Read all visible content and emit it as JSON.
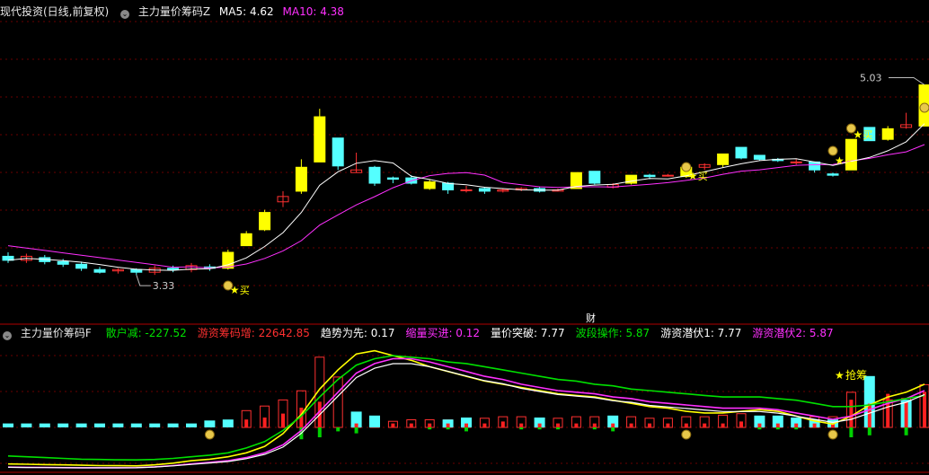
{
  "header_top": {
    "stock": "现代投资(日线,前复权)",
    "indicator": "主力量价筹码Z",
    "ma5": "MA5: 4.62",
    "ma10": "MA10: 4.38"
  },
  "header_bottom": {
    "indicator": "主力量价筹码F",
    "items": [
      {
        "text": "散户减: -227.52",
        "color": "#00e000"
      },
      {
        "text": "游资筹码增: 22642.85",
        "color": "#ff3030"
      },
      {
        "text": "趋势为先: 0.17",
        "color": "#ffffff"
      },
      {
        "text": "缩量买进: 0.12",
        "color": "#ff30ff"
      },
      {
        "text": "量价突破: 7.77",
        "color": "#ffffff"
      },
      {
        "text": "波段操作: 5.87",
        "color": "#00e000"
      },
      {
        "text": "游资潜伏1: 7.77",
        "color": "#ffffff"
      },
      {
        "text": "游资潜伏2: 5.87",
        "color": "#ff30ff"
      }
    ]
  },
  "divider_label": "财",
  "chart_data": [
    {
      "type": "candlestick",
      "price_range": [
        3.0,
        5.25
      ],
      "max_label": "5.03",
      "min_label": "3.33",
      "buy_label": "买",
      "ma_colors": {
        "ma5": "#ffffff",
        "ma10": "#ff30ff"
      },
      "candles": [
        [
          3.47,
          3.44,
          3.5,
          3.42
        ],
        [
          3.44,
          3.47,
          3.49,
          3.42
        ],
        [
          3.46,
          3.43,
          3.48,
          3.41
        ],
        [
          3.43,
          3.41,
          3.45,
          3.39
        ],
        [
          3.41,
          3.38,
          3.43,
          3.36
        ],
        [
          3.37,
          3.35,
          3.39,
          3.34
        ],
        [
          3.36,
          3.37,
          3.38,
          3.34
        ],
        [
          3.37,
          3.35,
          3.38,
          3.33
        ],
        [
          3.35,
          3.38,
          3.4,
          3.33
        ],
        [
          3.38,
          3.37,
          3.4,
          3.35
        ],
        [
          3.37,
          3.4,
          3.42,
          3.35
        ],
        [
          3.39,
          3.38,
          3.41,
          3.36
        ],
        [
          3.38,
          3.5,
          3.52,
          3.37
        ],
        [
          3.55,
          3.64,
          3.66,
          3.55
        ],
        [
          3.67,
          3.8,
          3.82,
          3.66
        ],
        [
          3.88,
          3.92,
          3.96,
          3.84
        ],
        [
          3.96,
          4.14,
          4.2,
          3.94
        ],
        [
          4.18,
          4.52,
          4.58,
          4.18
        ],
        [
          4.36,
          4.15,
          4.36,
          4.12
        ],
        [
          4.1,
          4.12,
          4.25,
          4.1
        ],
        [
          4.14,
          4.02,
          4.15,
          4.0
        ],
        [
          4.06,
          4.05,
          4.07,
          4.02
        ],
        [
          4.06,
          4.02,
          4.08,
          4.01
        ],
        [
          3.98,
          4.03,
          4.05,
          3.97
        ],
        [
          4.02,
          3.97,
          4.03,
          3.94
        ],
        [
          3.97,
          3.97,
          4.0,
          3.95
        ],
        [
          3.98,
          3.96,
          3.99,
          3.94
        ],
        [
          3.96,
          3.97,
          3.98,
          3.95
        ],
        [
          3.97,
          3.98,
          3.99,
          3.96
        ],
        [
          3.98,
          3.96,
          3.99,
          3.95
        ],
        [
          3.96,
          3.97,
          3.98,
          3.96
        ],
        [
          3.98,
          4.1,
          4.1,
          3.98
        ],
        [
          4.11,
          4.02,
          4.11,
          4.01
        ],
        [
          3.99,
          4.01,
          4.02,
          3.98
        ],
        [
          4.02,
          4.08,
          4.08,
          4.01
        ],
        [
          4.08,
          4.07,
          4.09,
          4.05
        ],
        [
          4.08,
          4.08,
          4.09,
          4.07
        ],
        [
          4.07,
          4.14,
          4.15,
          4.06
        ],
        [
          4.14,
          4.16,
          4.17,
          4.12
        ],
        [
          4.16,
          4.24,
          4.24,
          4.14
        ],
        [
          4.29,
          4.21,
          4.29,
          4.2
        ],
        [
          4.23,
          4.2,
          4.23,
          4.19
        ],
        [
          4.2,
          4.19,
          4.21,
          4.18
        ],
        [
          4.18,
          4.18,
          4.2,
          4.16
        ],
        [
          4.18,
          4.12,
          4.18,
          4.1
        ],
        [
          4.09,
          4.08,
          4.1,
          4.07
        ],
        [
          4.12,
          4.35,
          4.35,
          4.12
        ],
        [
          4.44,
          4.34,
          4.44,
          4.34
        ],
        [
          4.35,
          4.43,
          4.45,
          4.34
        ],
        [
          4.44,
          4.46,
          4.55,
          4.43
        ],
        [
          4.45,
          4.76,
          4.76,
          4.45
        ]
      ]
    },
    {
      "type": "mixed",
      "series": [
        {
          "name": "游资潜伏1",
          "color": "#ffff00",
          "values": [
            3,
            2.8,
            2.6,
            2.4,
            2.2,
            2,
            1.9,
            1.8,
            2.4,
            3.5,
            5,
            6,
            7.5,
            10,
            14,
            22,
            34,
            50,
            62,
            72,
            74,
            71,
            68,
            64,
            61,
            58,
            55,
            53,
            51,
            49,
            47,
            46,
            45,
            43,
            41,
            39,
            38,
            36,
            35,
            35,
            36,
            37,
            36,
            33,
            30,
            28,
            33,
            40,
            45,
            48,
            53
          ]
        },
        {
          "name": "游资潜伏2",
          "color": "#ff30ff",
          "values": [
            1,
            0.9,
            0.8,
            0.7,
            0.6,
            0.6,
            0.6,
            0.7,
            1.2,
            2,
            3,
            4,
            5,
            7,
            10,
            15,
            24,
            36,
            48,
            60,
            66,
            69,
            69,
            67,
            64,
            61,
            58,
            56,
            53,
            51,
            49,
            48,
            47,
            45,
            44,
            42,
            41,
            40,
            39,
            38,
            38,
            38,
            37,
            35,
            33,
            31,
            33,
            37,
            41,
            44,
            49
          ]
        },
        {
          "name": "波段操作",
          "color": "#00e000",
          "values": [
            8,
            7.5,
            7,
            6.5,
            6,
            5.8,
            5.6,
            5.5,
            5.8,
            6.5,
            7.5,
            8.5,
            10,
            13,
            17,
            24,
            33,
            45,
            56,
            65,
            69,
            71,
            70,
            69,
            67,
            66,
            64,
            62,
            60,
            58,
            56,
            55,
            53,
            52,
            50,
            49,
            48,
            47,
            46,
            45,
            45,
            45,
            44,
            43,
            41,
            39,
            39,
            40,
            42,
            44,
            46
          ]
        }
      ],
      "bars_hollow_red": [
        0,
        0,
        0,
        0,
        0,
        0,
        0,
        0,
        0,
        0,
        0,
        0,
        0,
        11,
        14,
        18,
        24,
        46,
        33,
        7,
        7,
        4,
        5,
        5,
        5,
        6,
        6,
        7,
        7,
        6,
        6,
        7,
        7,
        6,
        7,
        6,
        6,
        7,
        7,
        8,
        9,
        6,
        6,
        6,
        7,
        7,
        23,
        24,
        18,
        19,
        28
      ],
      "bars_cyan": [
        2,
        2,
        2,
        2,
        2,
        2,
        2,
        2,
        2,
        2,
        2,
        3.5,
        4,
        0,
        0,
        0,
        0,
        0,
        0,
        8,
        6,
        0,
        0,
        0,
        4,
        5,
        0,
        0,
        0,
        5,
        0,
        0,
        0,
        6,
        0,
        0,
        0,
        0,
        0,
        0,
        0,
        6,
        6,
        5,
        4,
        4,
        0,
        26,
        0,
        14,
        0
      ],
      "bars_red": [
        0,
        0,
        0,
        0,
        0,
        0,
        0,
        0,
        0,
        0,
        0,
        0,
        0,
        4,
        5,
        7,
        10,
        13,
        0,
        2,
        0,
        2,
        2,
        2,
        2,
        2,
        2,
        3,
        2,
        2,
        2,
        2,
        2,
        2,
        2,
        2,
        2,
        2,
        2,
        2,
        3,
        2,
        2,
        2,
        2,
        2,
        14,
        12,
        17,
        13,
        18
      ],
      "bars_green": [
        0,
        0,
        0,
        0,
        0,
        0,
        0,
        0,
        0,
        0,
        0,
        0,
        0,
        0,
        0,
        0,
        -6,
        -5,
        -2,
        -3,
        0,
        0,
        0,
        -1,
        -1,
        -2,
        0,
        0,
        -1,
        -1,
        -1,
        0,
        -1,
        -2,
        0,
        0,
        0,
        0,
        0,
        0,
        0,
        -1,
        -1,
        -1,
        0,
        0,
        -5,
        -4,
        0,
        -4,
        0
      ],
      "annotation": "抢筹"
    }
  ]
}
